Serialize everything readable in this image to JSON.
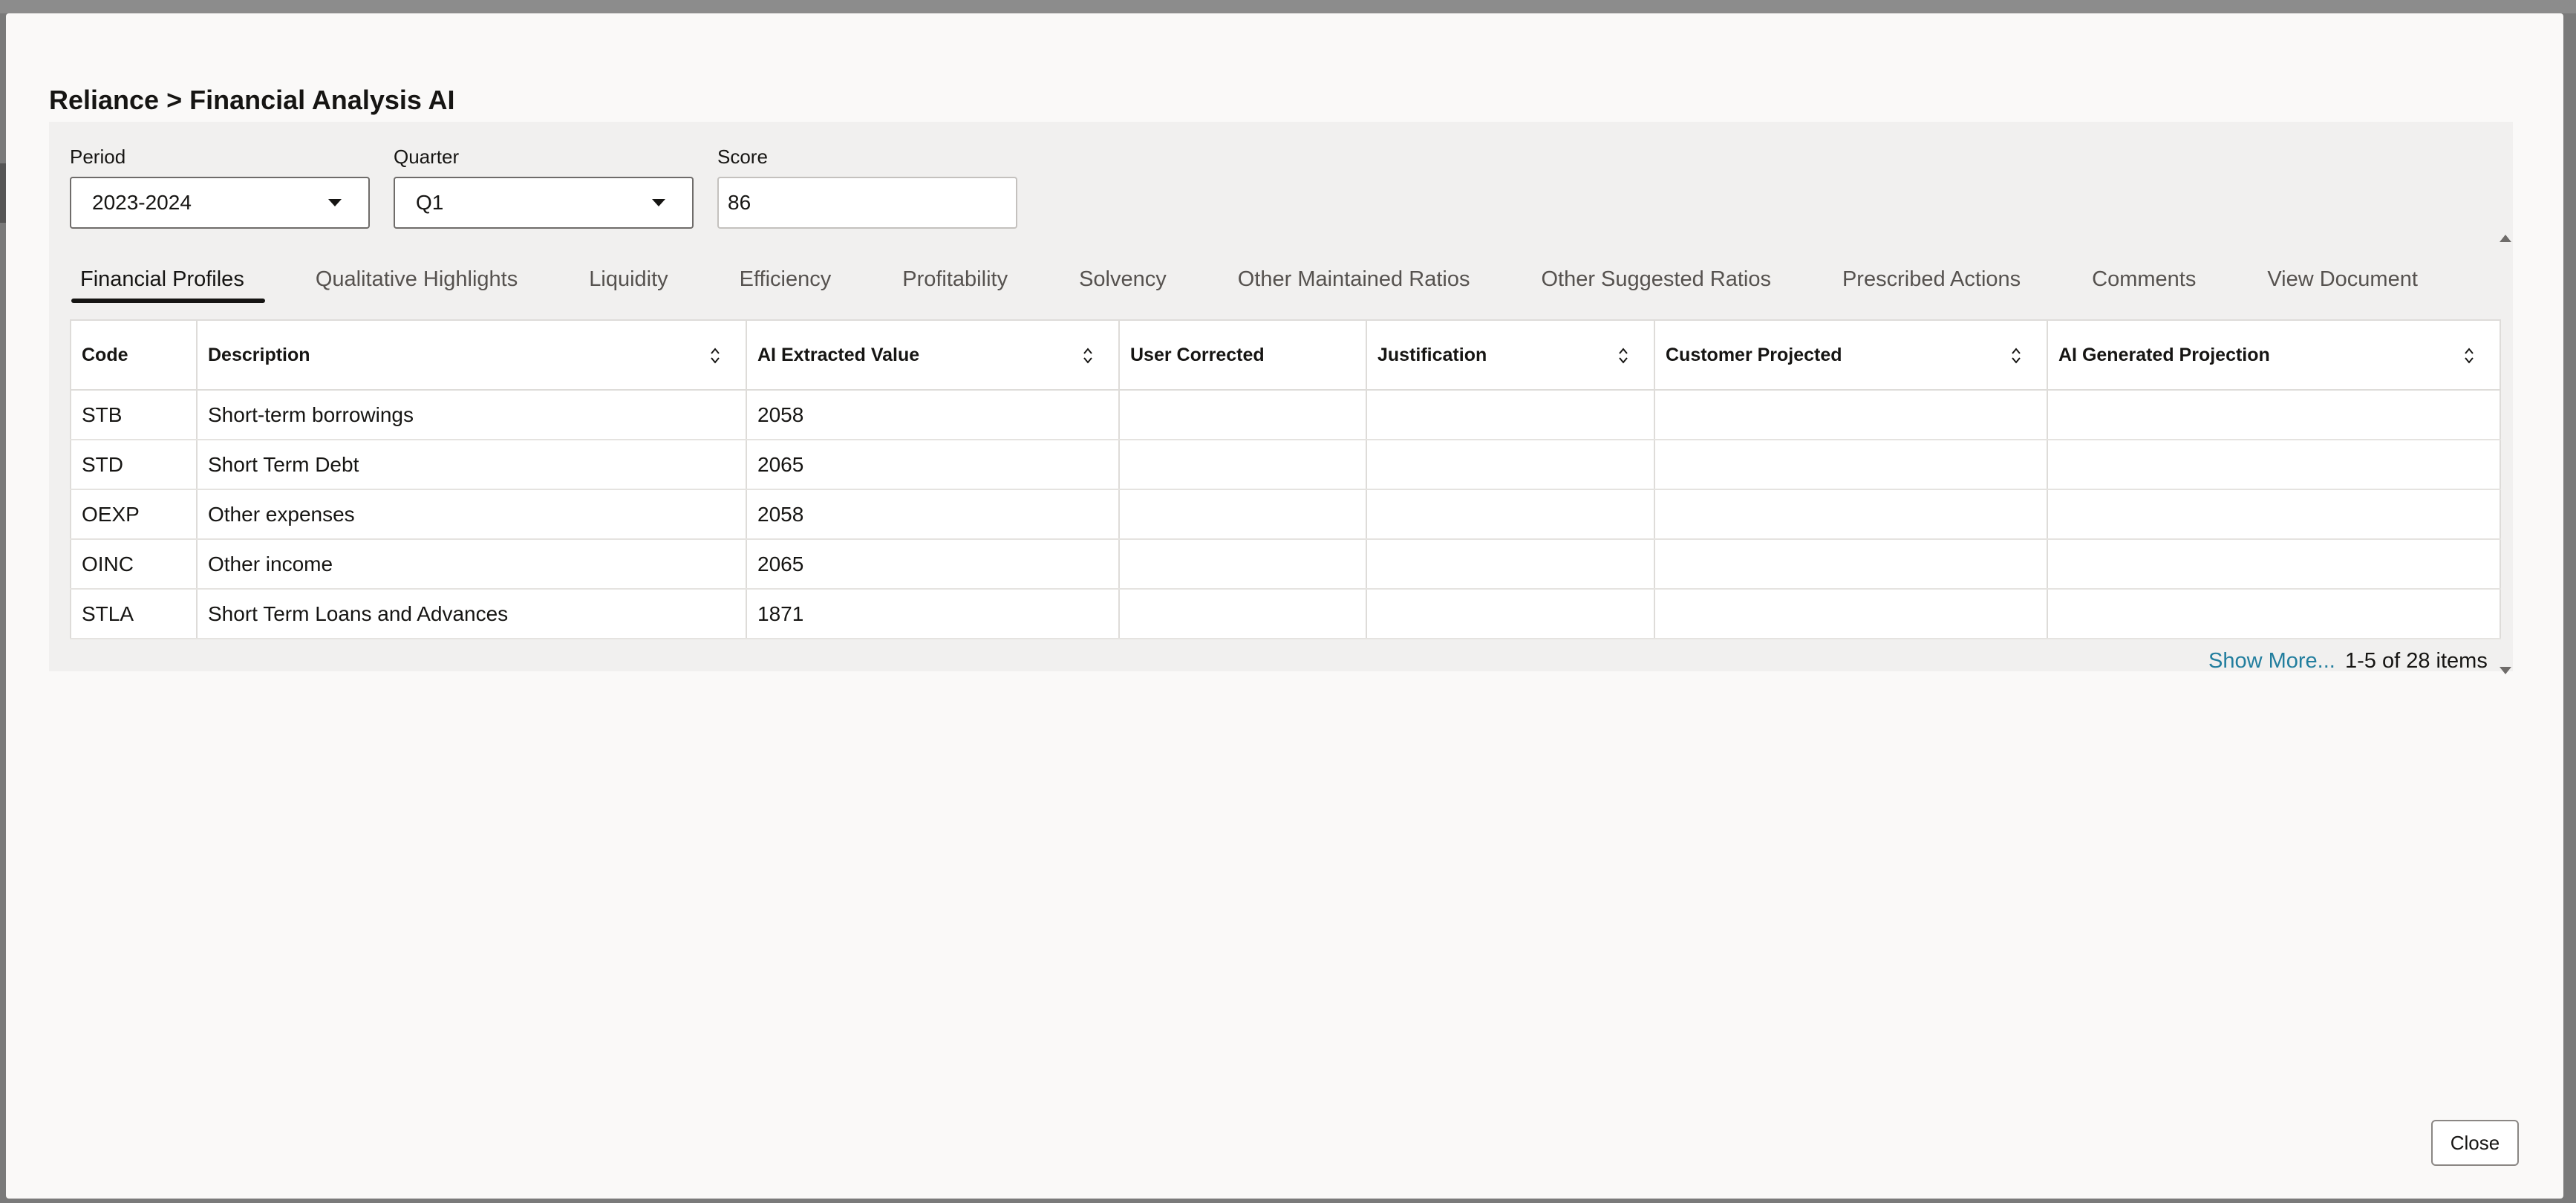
{
  "header": {
    "title": "Reliance > Financial Analysis AI"
  },
  "filters": {
    "period": {
      "label": "Period",
      "value": "2023-2024"
    },
    "quarter": {
      "label": "Quarter",
      "value": "Q1"
    },
    "score": {
      "label": "Score",
      "value": "86"
    }
  },
  "tabs": [
    {
      "label": "Financial Profiles",
      "active": true
    },
    {
      "label": "Qualitative Highlights",
      "active": false
    },
    {
      "label": "Liquidity",
      "active": false
    },
    {
      "label": "Efficiency",
      "active": false
    },
    {
      "label": "Profitability",
      "active": false
    },
    {
      "label": "Solvency",
      "active": false
    },
    {
      "label": "Other Maintained Ratios",
      "active": false
    },
    {
      "label": "Other Suggested Ratios",
      "active": false
    },
    {
      "label": "Prescribed Actions",
      "active": false
    },
    {
      "label": "Comments",
      "active": false
    },
    {
      "label": "View Document",
      "active": false
    }
  ],
  "table": {
    "columns": [
      {
        "label": "Code",
        "sortable": false
      },
      {
        "label": "Description",
        "sortable": true
      },
      {
        "label": "AI Extracted Value",
        "sortable": true
      },
      {
        "label": "User Corrected",
        "sortable": false
      },
      {
        "label": "Justification",
        "sortable": true
      },
      {
        "label": "Customer Projected",
        "sortable": true
      },
      {
        "label": "AI Generated Projection",
        "sortable": true
      }
    ],
    "rows": [
      [
        "STB",
        "Short-term borrowings",
        "2058",
        "",
        "",
        "",
        ""
      ],
      [
        "STD",
        "Short Term Debt",
        "2065",
        "",
        "",
        "",
        ""
      ],
      [
        "OEXP",
        "Other expenses",
        "2058",
        "",
        "",
        "",
        ""
      ],
      [
        "OINC",
        "Other income",
        "2065",
        "",
        "",
        "",
        ""
      ],
      [
        "STLA",
        "Short Term Loans and Advances",
        "1871",
        "",
        "",
        "",
        ""
      ]
    ]
  },
  "footer": {
    "show_more": "Show More...",
    "pager": "1-5 of 28 items"
  },
  "actions": {
    "close_label": "Close"
  },
  "icons": {
    "select_caret": "caret-down-icon",
    "column_sort": "sort-icon",
    "scroll_up": "scroll-up-icon",
    "scroll_down": "scroll-down-icon"
  }
}
